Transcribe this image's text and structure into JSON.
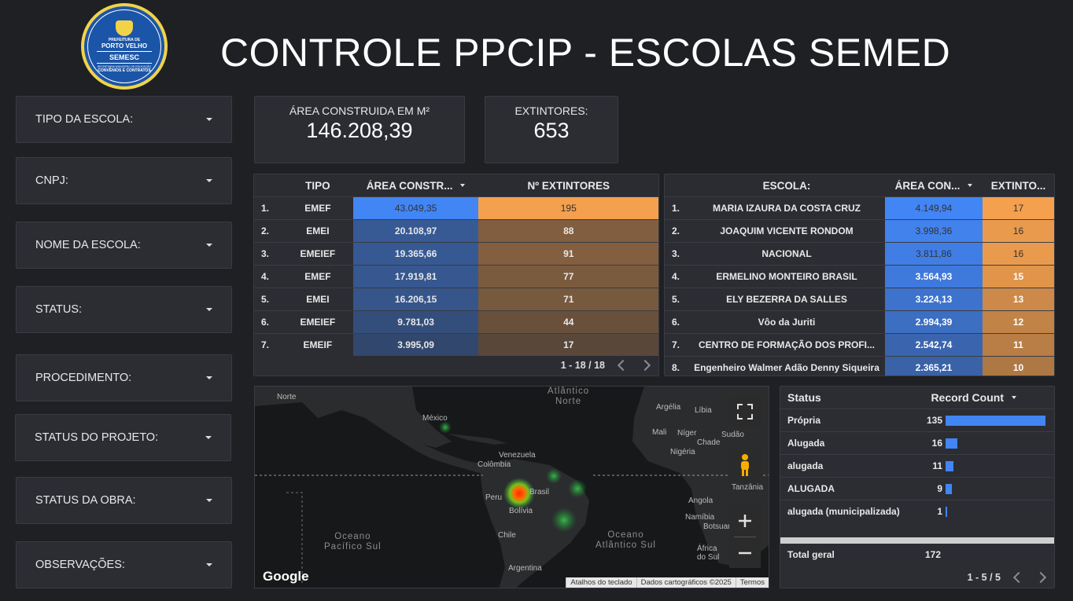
{
  "header": {
    "title": "CONTROLE PPCIP - ESCOLAS SEMED",
    "logo": {
      "top_text": "PREFEITURA DE",
      "city": "PORTO VELHO",
      "name": "SEMESC",
      "subtitle": "SECRETARIA MUNICIPAL DE EDUCAÇÃO",
      "bottom_text": "CONVÊNIOS E CONTRATOS"
    }
  },
  "filters": [
    {
      "label": "TIPO DA ESCOLA:"
    },
    {
      "label": "CNPJ:"
    },
    {
      "label": "NOME DA ESCOLA:"
    },
    {
      "label": "STATUS:"
    },
    {
      "label": "PROCEDIMENTO:"
    },
    {
      "label": "STATUS DO PROJETO:"
    },
    {
      "label": "STATUS DA OBRA:"
    },
    {
      "label": "OBSERVAÇÕES:"
    }
  ],
  "kpis": {
    "area": {
      "label": "ÁREA CONSTRUIDA EM M²",
      "value": "146.208,39"
    },
    "extintores": {
      "label": "EXTINTORES:",
      "value": "653"
    }
  },
  "tipo_table": {
    "headers": {
      "tipo": "TIPO",
      "area": "ÁREA CONSTR...",
      "ext": "Nº EXTINTORES"
    },
    "rows": [
      {
        "idx": "1.",
        "tipo": "EMEF",
        "area": "43.049,35",
        "area_num": 43049.35,
        "ext": "195",
        "ext_num": 195
      },
      {
        "idx": "2.",
        "tipo": "EMEI",
        "area": "20.108,97",
        "area_num": 20108.97,
        "ext": "88",
        "ext_num": 88
      },
      {
        "idx": "3.",
        "tipo": "EMEIEF",
        "area": "19.365,66",
        "area_num": 19365.66,
        "ext": "91",
        "ext_num": 91
      },
      {
        "idx": "4.",
        "tipo": "EMEF",
        "area": "17.919,81",
        "area_num": 17919.81,
        "ext": "77",
        "ext_num": 77
      },
      {
        "idx": "5.",
        "tipo": "EMEI",
        "area": "16.206,15",
        "area_num": 16206.15,
        "ext": "71",
        "ext_num": 71
      },
      {
        "idx": "6.",
        "tipo": "EMEIEF",
        "area": "9.781,03",
        "area_num": 9781.03,
        "ext": "44",
        "ext_num": 44
      },
      {
        "idx": "7.",
        "tipo": "EMEIF",
        "area": "3.995,09",
        "area_num": 3995.09,
        "ext": "17",
        "ext_num": 17
      }
    ],
    "pagination": "1 - 18 / 18"
  },
  "escola_table": {
    "headers": {
      "escola": "ESCOLA:",
      "area": "ÁREA CON...",
      "ext": "EXTINTO..."
    },
    "rows": [
      {
        "idx": "1.",
        "escola": "MARIA IZAURA DA COSTA CRUZ",
        "area": "4.149,94",
        "area_num": 4149.94,
        "ext": "17",
        "ext_num": 17
      },
      {
        "idx": "2.",
        "escola": "JOAQUIM VICENTE RONDOM",
        "area": "3.998,36",
        "area_num": 3998.36,
        "ext": "16",
        "ext_num": 16
      },
      {
        "idx": "3.",
        "escola": "NACIONAL",
        "area": "3.811,86",
        "area_num": 3811.86,
        "ext": "16",
        "ext_num": 16
      },
      {
        "idx": "4.",
        "escola": "ERMELINO MONTEIRO BRASIL",
        "area": "3.564,93",
        "area_num": 3564.93,
        "ext": "15",
        "ext_num": 15
      },
      {
        "idx": "5.",
        "escola": "ELY BEZERRA DA SALLES",
        "area": "3.224,13",
        "area_num": 3224.13,
        "ext": "13",
        "ext_num": 13
      },
      {
        "idx": "6.",
        "escola": "Vôo da Juriti",
        "area": "2.994,39",
        "area_num": 2994.39,
        "ext": "12",
        "ext_num": 12
      },
      {
        "idx": "7.",
        "escola": "CENTRO DE FORMAÇÃO DOS PROFI...",
        "area": "2.542,74",
        "area_num": 2542.74,
        "ext": "11",
        "ext_num": 11
      },
      {
        "idx": "8.",
        "escola": "Engenheiro Walmer Adão Denny Siqueira",
        "area": "2.365,21",
        "area_num": 2365.21,
        "ext": "10",
        "ext_num": 10
      }
    ]
  },
  "map": {
    "labels": {
      "norte_left": "Norte",
      "atlantico_norte_1": "Atlântico",
      "atlantico_norte_2": "Norte",
      "mexico": "México",
      "venezuela": "Venezuela",
      "colombia": "Colômbia",
      "peru": "Peru",
      "brasil": "Brasil",
      "bolivia": "Bolívia",
      "chile": "Chile",
      "argentina": "Argentina",
      "argelia": "Argélia",
      "libia": "Líbia",
      "mali": "Mali",
      "niger": "Níger",
      "chade": "Chade",
      "sudao": "Sudão",
      "nigeria": "Nigéria",
      "tanzania": "Tanzânia",
      "angola": "Angola",
      "namibia": "Namíbia",
      "botsuana": "Botsuana",
      "africa_do_sul_1": "África",
      "africa_do_sul_2": "do Sul",
      "oceano_pacifico_1": "Oceano",
      "oceano_pacifico_2": "Pacífico Sul",
      "oceano_atlantico_1": "Oceano",
      "oceano_atlantico_2": "Atlântico Sul"
    },
    "google": "Google",
    "footer": [
      "Atalhos do teclado",
      "Dados cartográficos ©2025",
      "Termos"
    ],
    "icons": [
      "fullscreen-icon",
      "pegman-icon",
      "zoom-in-icon",
      "zoom-out-icon"
    ]
  },
  "status_table": {
    "headers": {
      "status": "Status",
      "count": "Record Count"
    },
    "rows": [
      {
        "name": "Própria",
        "count": "135",
        "count_num": 135
      },
      {
        "name": "Alugada",
        "count": "16",
        "count_num": 16
      },
      {
        "name": "alugada",
        "count": "11",
        "count_num": 11
      },
      {
        "name": "ALUGADA",
        "count": "9",
        "count_num": 9
      },
      {
        "name": "alugada (municipalizada)",
        "count": "1",
        "count_num": 1
      }
    ],
    "total_label": "Total geral",
    "total_value": "172",
    "pagination": "1 - 5 / 5"
  },
  "colors": {
    "area_bar": "#4285f4",
    "ext_bar": "#f4a04e",
    "background": "#1f2023",
    "panel": "#2b2d33"
  }
}
